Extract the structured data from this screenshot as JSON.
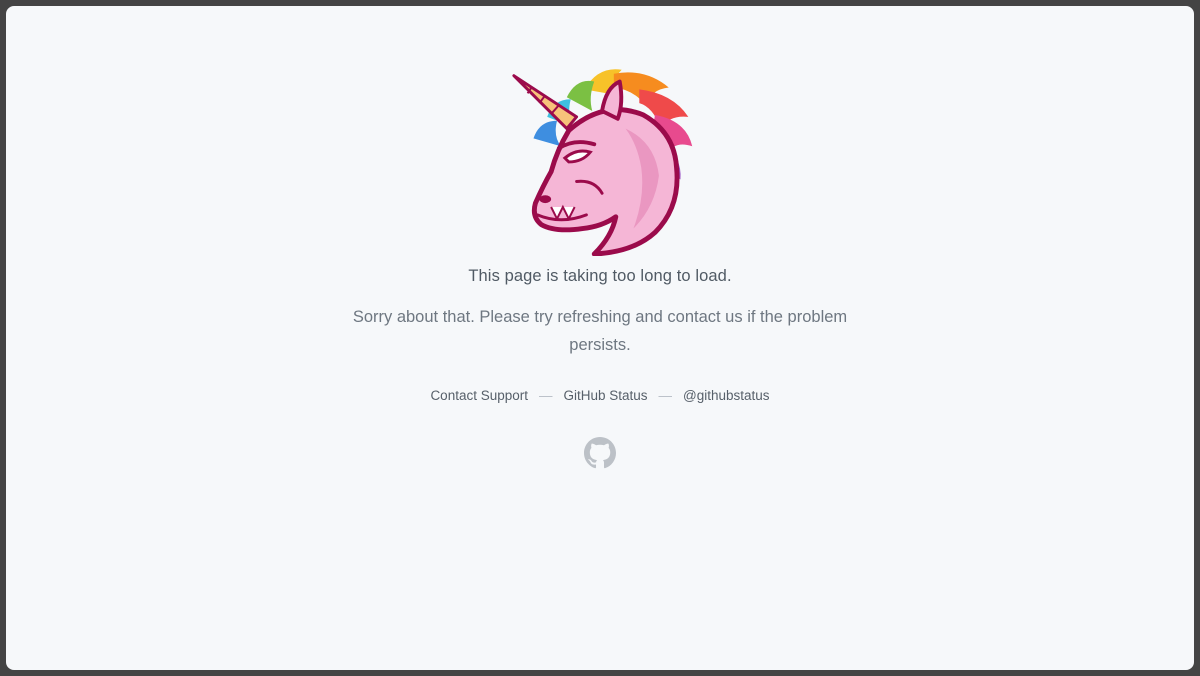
{
  "page": {
    "headline": "This page is taking too long to load.",
    "message": "Sorry about that. Please try refreshing and contact us if the problem persists.",
    "illustration_icon": "unicorn-icon",
    "logo_icon": "github-octocat-icon"
  },
  "footer_links": [
    {
      "label": "Contact Support"
    },
    {
      "label": "GitHub Status"
    },
    {
      "label": "@githubstatus"
    }
  ],
  "separator": "—",
  "colors": {
    "page_background": "#f6f8fa",
    "outer_frame": "#444444",
    "headline_text": "#505a64",
    "body_text": "#6e7781",
    "icon_gray": "#bcc1c7",
    "unicorn_pink": "#f5b6d6",
    "unicorn_outline": "#9b0b4b"
  }
}
